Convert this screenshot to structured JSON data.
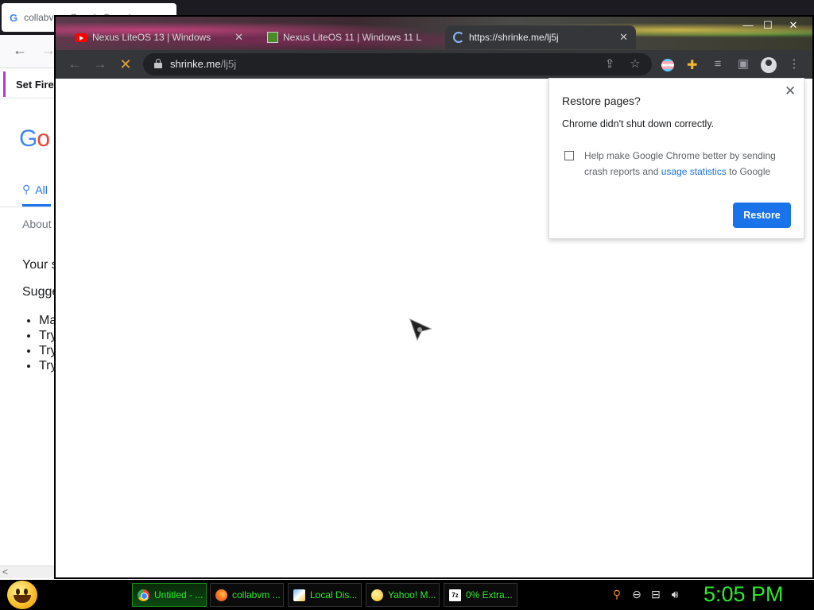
{
  "bg_window": {
    "tab_title": "collabvm - Google Search",
    "notice": "Set Firef",
    "logo_blue": "G",
    "logo_red": "o",
    "tab_all": "All",
    "about": "About",
    "your": "Your s",
    "suggestions": "Sugge",
    "list": [
      "Ma",
      "Try",
      "Try",
      "Try"
    ],
    "scroll_left": "<"
  },
  "chrome": {
    "tabs": [
      {
        "label": "Nexus LiteOS 13 | Windows"
      },
      {
        "label": "Nexus LiteOS 11 | Windows 11 L"
      },
      {
        "label": "https://shrinke.me/lj5j"
      }
    ],
    "controls": {
      "min": "—",
      "max": "☐",
      "close": "✕"
    },
    "url_host": "shrinke.me",
    "url_path": "/lj5j",
    "restore_popup": {
      "title": "Restore pages?",
      "message": "Chrome didn't shut down correctly.",
      "help_prefix": "Help make Google Chrome better by sending crash reports and",
      "help_link": "usage statistics",
      "help_suffix": "to Google",
      "button": "Restore"
    }
  },
  "taskbar": {
    "items": [
      {
        "label": "Untitled - ...",
        "icon": "chrome-icon"
      },
      {
        "label": "collabvm ...",
        "icon": "firefox-icon"
      },
      {
        "label": "Local Dis...",
        "icon": "disk-icon"
      },
      {
        "label": "Yahoo! M...",
        "icon": "yahoo-icon"
      },
      {
        "label": "0% Extra...",
        "icon": "7zip-icon"
      }
    ],
    "clock": "5:05 PM"
  }
}
